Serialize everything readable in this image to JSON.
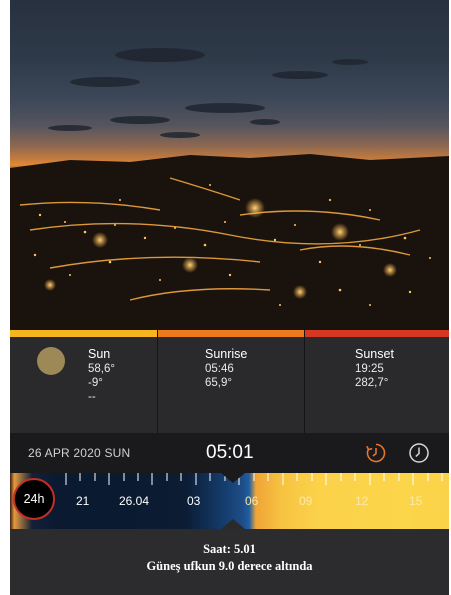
{
  "info": {
    "sun": {
      "title": "Sun",
      "elevation": "58,6°",
      "azimuth": "-9°",
      "extra": "--"
    },
    "sunrise": {
      "title": "Sunrise",
      "time": "05:46",
      "azimuth": "65,9°"
    },
    "sunset": {
      "title": "Sunset",
      "time": "19:25",
      "azimuth": "282,7°"
    }
  },
  "datebar": {
    "date": "26 APR 2020 SUN",
    "time": "05:01"
  },
  "timeline": {
    "mode_label": "24h",
    "labels": [
      "21",
      "26.04",
      "03",
      "06",
      "09",
      "12",
      "15"
    ]
  },
  "footer": {
    "line1": "Saat: 5.01",
    "line2": "Güneş ufkun 9.0 derece altında"
  },
  "icons": {
    "sun_disc": "sun-disc-icon",
    "reset": "reset-time-icon",
    "clock": "clock-icon"
  },
  "colors": {
    "sun_bar": "#f5b51e",
    "sunrise_bar": "#ec7a1c",
    "sunset_bar": "#d43722"
  }
}
